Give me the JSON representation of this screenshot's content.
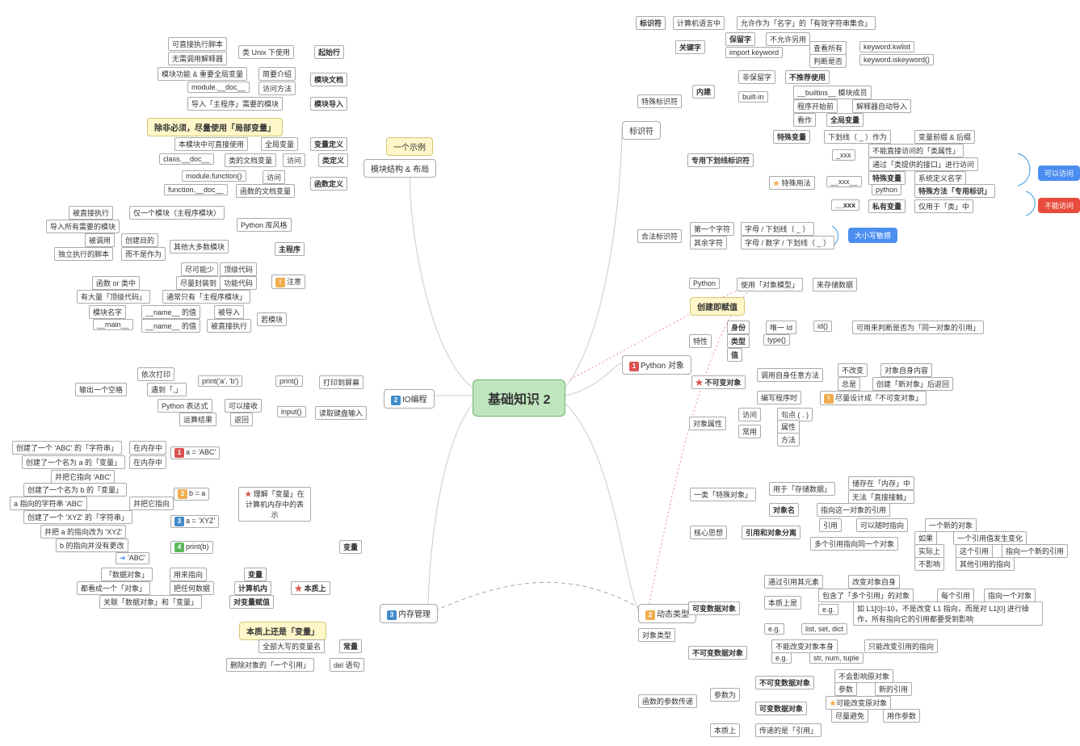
{
  "center": "基础知识 2",
  "l1": {
    "title": "模块结构 & 布局",
    "tip": "一个示例"
  },
  "l2": "IO编程",
  "l3": "内存管理",
  "r1": "标识符",
  "r2": "Python 对象",
  "r3": "动态类型",
  "yellow1": "除非必须，尽量使用「局部变量」",
  "yellow2": "本质上还是「变量」",
  "yellow3": "创建即赋值",
  "left": {
    "qishi": "起始行",
    "qishi_a": "可直接执行脚本",
    "qishi_b": "无需调用解释器",
    "qishi_c": "类 Unix 下使用",
    "doc": "模块文档",
    "doc_a": "模块功能 & 重要全局变量",
    "doc_b": "简要介绍",
    "doc_c": "module.__doc__",
    "doc_d": "访问方法",
    "imp": "模块导入",
    "imp_a": "导入「主程序」需要的模块",
    "vdef": "变量定义",
    "vdef_a": "本模块中可直接使用",
    "vdef_b": "全局变量",
    "cdef": "类定义",
    "cdef_a": "class.__doc__",
    "cdef_b": "类的文档变量",
    "cdef_c": "访问",
    "fdef": "函数定义",
    "fdef_a": "module.function()",
    "fdef_b": "访问",
    "fdef_c": "function.__doc__",
    "fdef_d": "函数的文档变量",
    "main": "主程序",
    "m_a": "被直接执行",
    "m_b": "导入所有需要的模块",
    "m_c": "被调用",
    "m_d": "独立执行的脚本",
    "m_e": "仅一个模块（主程序模块）",
    "m_f": "创建目的",
    "m_g": "而不是作为",
    "m_h": "其他大多数模块",
    "m_i": "Python 库风格",
    "m_j": "尽可能少",
    "m_k": "顶级代码",
    "m_l": "函数 or 类中",
    "m_m": "尽量封装到",
    "m_n": "功能代码",
    "m_o": "有大量「顶级代码」",
    "m_p": "通常只有「主程序模块」",
    "m_note": "注意",
    "m_q": "模块名字",
    "m_r": "__name__ 的值",
    "m_s": "被导入",
    "m_t": "__main__",
    "m_u": "__name__ 的值",
    "m_v": "被直接执行",
    "m_w": "若模块",
    "io_a": "print()",
    "io_b": "打印到屏幕",
    "io_c": "依次打印",
    "io_d": "print('a', 'b')",
    "io_e": "遇到「,」",
    "io_f": "输出一个空格",
    "io_g": "input()",
    "io_h": "读取键盘输入",
    "io_i": "Python 表达式",
    "io_j": "可以接收",
    "io_k": "运算结果",
    "io_l": "返回",
    "mem_v": "变量",
    "mem_vopt": "理解「变量」在",
    "mem_vopt2": "计算机内存中的表示",
    "s1": "a = 'ABC'",
    "s1a": "创建了一个 'ABC' 的「字符串」",
    "s1b": "在内存中",
    "s1c": "创建了一个名为 a 的「变量」",
    "s1d": "在内存中",
    "s1e": "并把它指向 'ABC'",
    "s2": "b = a",
    "s2a": "创建了一个名为 b 的「变量」",
    "s2b": "a 指向的字符串 'ABC'",
    "s2c": "并把它指向",
    "s3": "a = 'XYZ'",
    "s3a": "创建了一个 'XYZ' 的「字符串」",
    "s3b": "并把 a 的指向改为 'XYZ'",
    "s3c": "b 的指向并没有更改",
    "s4": "print(b)",
    "s4a": "'ABC'",
    "ess": "本质上",
    "ess_a": "变量",
    "ess_b": "「数据对象」",
    "ess_c": "用来指向",
    "ess_d": "计算机内",
    "ess_e": "把任何数据",
    "ess_f": "都看成一个「对象」",
    "ess_g": "对变量赋值",
    "ess_h": "关联「数据对象」和「变量」",
    "const": "常量",
    "const_a": "全部大写的变量名",
    "del": "del 语句",
    "del_a": "删除对象的「一个引用」"
  },
  "right": {
    "ident": "标识符",
    "ident_a": "计算机语言中",
    "ident_b": "允许作为「名字」的「有效字符串集合」",
    "kw": "关键字",
    "kw_a": "保留字",
    "kw_b": "不允许另用",
    "kw_c": "import keyword",
    "kw_d": "查看所有",
    "kw_e": "keyword.kwlist",
    "kw_f": "判断是否",
    "kw_g": "keyword.iskeyword()",
    "spec": "特殊标识符",
    "builtin": "内建",
    "bi_a": "非保留字",
    "bi_b": "不推荐使用",
    "bi_c": "built-in",
    "bi_d": "__builtins__ 模块成员",
    "bi_e": "程序开始前",
    "bi_f": "解释器自动导入",
    "bi_g": "看作",
    "bi_h": "全局变量",
    "uid": "专用下划线标识符",
    "uid_a": "特殊变量",
    "uid_b": "下划线（ _ ）作为",
    "uid_c": "变量前缀 & 后缀",
    "ux": "_xxx",
    "ux_a": "不能直接访问的「类属性」",
    "ux_b": "通过「类提供的接口」进行访问",
    "uxx": "__xxx__",
    "uxx_a": "特殊变量",
    "uxx_b": "系统定义名字",
    "uxx_c": "python",
    "uxx_d": "特殊方法「专用标识」",
    "uxx_n": "特殊用法",
    "uxxx": "__xxx",
    "uxxx_a": "私有变量",
    "uxxx_b": "仅用于「类」中",
    "legal": "合法标识符",
    "lg_a": "第一个字符",
    "lg_b": "字母 / 下划线（ _ ）",
    "lg_c": "其余字符",
    "lg_d": "字母 / 数字 / 下划线（ _ ）",
    "case": "大小写敏感",
    "canv": "可以访问",
    "canntv": "不能访问",
    "po_a": "Python",
    "po_b": "使用「对象模型」",
    "po_c": "来存储数据",
    "ch": "特性",
    "id": "身份",
    "id_a": "唯一 Id",
    "id_b": "id()",
    "id_c": "可用来判断是否为「同一对象的引用」",
    "tp": "类型",
    "tp_a": "type()",
    "val": "值",
    "imm": "不可变对象",
    "imm_a": "调用自身任意方法",
    "imm_b": "不改变",
    "imm_c": "对象自身内容",
    "imm_d": "总是",
    "imm_e": "创建「新对象」后返回",
    "imm_f": "编写程序时",
    "imm_g": "尽量设计成「不可变对象」",
    "attr": "对象属性",
    "attr_a": "访问",
    "attr_b": "句点 ( . )",
    "attr_c": "常用",
    "attr_d": "属性",
    "attr_e": "方法",
    "dt_a": "一类「特殊对象」",
    "dt_b": "用于「存储数据」",
    "dt_c": "储存在「内存」中",
    "dt_d": "无法「直接接触」",
    "dt_e": "对象名",
    "dt_f": "指向这一对象的引用",
    "core": "核心思想",
    "rs": "引用和对象分离",
    "rs_a": "引用",
    "rs_b": "可以随时指向",
    "rs_c": "一个新的对象",
    "rs_d": "多个引用指向同一个对象",
    "rs_e": "如果",
    "rs_f": "一个引用值发生变化",
    "rs_g": "实际上",
    "rs_h": "这个引用",
    "rs_i": "指向一个新的引用",
    "rs_j": "不影响",
    "rs_k": "其他引用的指向",
    "ot": "对象类型",
    "mdo": "可变数据对象",
    "mdo_a": "通过引用其元素",
    "mdo_b": "改变对象自身",
    "mdo_c": "本质上是",
    "mdo_d": "包含了「多个引用」的对象",
    "mdo_e": "每个引用",
    "mdo_f": "指向一个对象",
    "mdo_g": "e.g.",
    "mdo_h": "如 L1[0]=10，不是改变 L1 指向，而是对 L1[0] 进行操作，所有指向它的引用都要受到影响",
    "mdo_i": "e.g.",
    "mdo_j": "list, set, dict",
    "imdo": "不可变数据对象",
    "imdo_a": "不能改变对象本身",
    "imdo_b": "只能改变引用的指向",
    "imdo_c": "e.g.",
    "imdo_d": "str, num, tuple",
    "fp": "函数的参数传递",
    "fp_a": "参数为",
    "fp_b": "不可变数据对象",
    "fp_c": "不会影响原对象",
    "fp_d": "参数",
    "fp_e": "新的引用",
    "fp_f": "可变数据对象",
    "fp_g": "可能改变原对象",
    "fp_h": "尽量避免",
    "fp_i": "用作参数",
    "fp_j": "本质上",
    "fp_k": "传递的是「引用」"
  }
}
